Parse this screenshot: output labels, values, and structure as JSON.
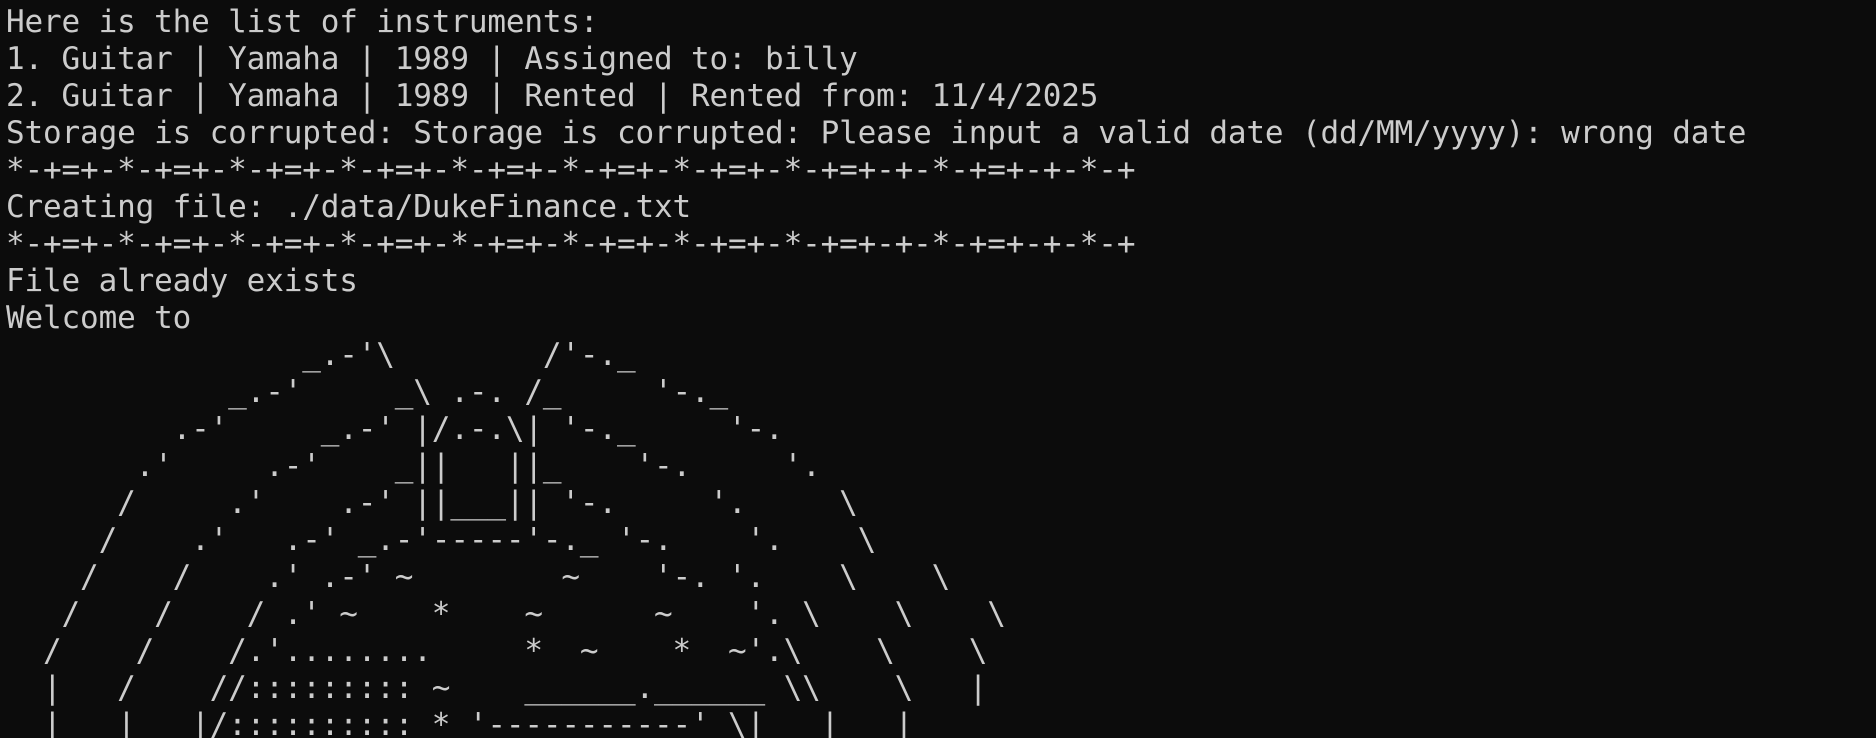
{
  "terminal": {
    "colors": {
      "background": "#0c0c0c",
      "text": "#cccccc"
    },
    "lines": [
      "Here is the list of instruments:",
      "1. Guitar | Yamaha | 1989 | Assigned to: billy",
      "2. Guitar | Yamaha | 1989 | Rented | Rented from: 11/4/2025",
      "Storage is corrupted: Storage is corrupted: Please input a valid date (dd/MM/yyyy): wrong date",
      "*-+=+-*-+=+-*-+=+-*-+=+-*-+=+-*-+=+-*-+=+-*-+=+-+-*-+=+-+-*-+",
      "Creating file: ./data/DukeFinance.txt",
      "*-+=+-*-+=+-*-+=+-*-+=+-*-+=+-*-+=+-*-+=+-*-+=+-+-*-+=+-+-*-+",
      "File already exists",
      "Welcome to",
      "                _.-'\\        /'-._",
      "            _.-'     _\\ .-. /_     '-._",
      "         .-'     _.-' |/.-.\\| '-._     '-.",
      "       .'     .-'    _||   ||_    '-.     '.",
      "      /     .'    .-' ||___|| '-.     '.     \\",
      "     /    .'   .-' _.-'-----'-._ '-.    '.    \\",
      "    /    /    .' .-' ~        ~    '-. '.    \\    \\",
      "   /    /    / .' ~    *    ~      ~    '. \\    \\    \\",
      "  /    /    /.'........     *  ~    *  ~'.\\    \\    \\",
      "  |   /    //::::::::: ~    ______.______ \\\\    \\   |",
      "  |   |   |/:::::::::: * '-----------' \\|   |   |"
    ]
  }
}
